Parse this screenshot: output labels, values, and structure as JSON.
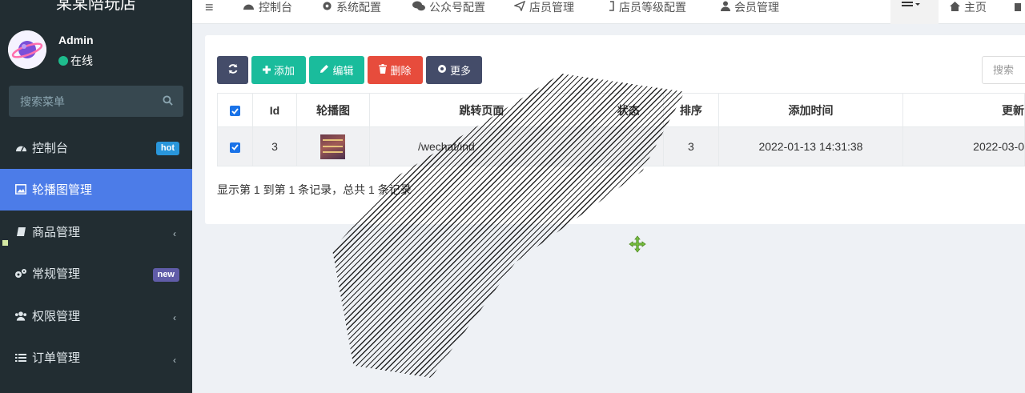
{
  "app": {
    "brand": "某某陪玩店"
  },
  "user": {
    "name": "Admin",
    "status": "在线"
  },
  "sidebar": {
    "search_placeholder": "搜索菜单",
    "items": [
      {
        "label": "控制台",
        "badge": "hot",
        "icon": "dashboard-icon"
      },
      {
        "label": "轮播图管理",
        "active": true,
        "icon": "image-icon"
      },
      {
        "label": "商品管理",
        "chevron": "‹",
        "icon": "book-icon"
      },
      {
        "label": "常规管理",
        "badge": "new",
        "icon": "gears-icon"
      },
      {
        "label": "权限管理",
        "chevron": "‹",
        "icon": "group-icon"
      },
      {
        "label": "订单管理",
        "chevron": "‹",
        "icon": "list-icon"
      }
    ]
  },
  "topnav": {
    "menu_glyph": "≡",
    "tabs": [
      {
        "label": "控制台",
        "icon": "dashboard-icon"
      },
      {
        "label": "系统配置",
        "icon": "gear-icon"
      },
      {
        "label": "公众号配置",
        "icon": "wechat-icon"
      },
      {
        "label": "店员管理",
        "icon": "send-icon"
      },
      {
        "label": "店员等级配置",
        "icon": "level-icon"
      },
      {
        "label": "会员管理",
        "icon": "user-icon"
      }
    ],
    "home_label": "主页"
  },
  "toolbar": {
    "add_label": "添加",
    "edit_label": "编辑",
    "delete_label": "删除",
    "more_label": "更多",
    "search_placeholder": "搜索"
  },
  "table": {
    "headers": [
      "Id",
      "轮播图",
      "跳转页面",
      "状态",
      "排序",
      "添加时间",
      "更新"
    ],
    "rows": [
      {
        "checked": true,
        "id": "3",
        "url": "/wechat/ind",
        "status": "",
        "sort": "3",
        "created": "2022-01-13 14:31:38",
        "updated": "2022-03-0"
      }
    ]
  },
  "pagination": {
    "summary": "显示第 1 到第 1 条记录，总共 1 条记录"
  },
  "colors": {
    "sidebar_bg": "#222d32",
    "active": "#4c7ce8",
    "green": "#1abc9c",
    "red": "#e74c3c",
    "dark": "#444c69"
  }
}
